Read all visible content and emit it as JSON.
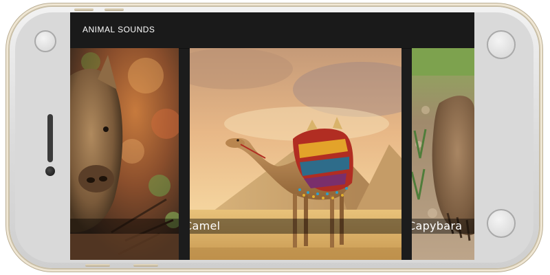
{
  "app": {
    "title": "ANIMAL SOUNDS"
  },
  "cards": [
    {
      "id": "boar",
      "caption": "",
      "image": "boar-photo"
    },
    {
      "id": "camel",
      "caption": "Camel",
      "image": "camel-pyramids-photo"
    },
    {
      "id": "capybara",
      "caption": "Capybara",
      "image": "capybara-photo"
    }
  ],
  "colors": {
    "appbar": "#1a1a1a",
    "caption_overlay": "rgba(0,0,0,0.42)",
    "device_frame": "#d9d9d9",
    "device_trim": "#c9bfa7"
  }
}
